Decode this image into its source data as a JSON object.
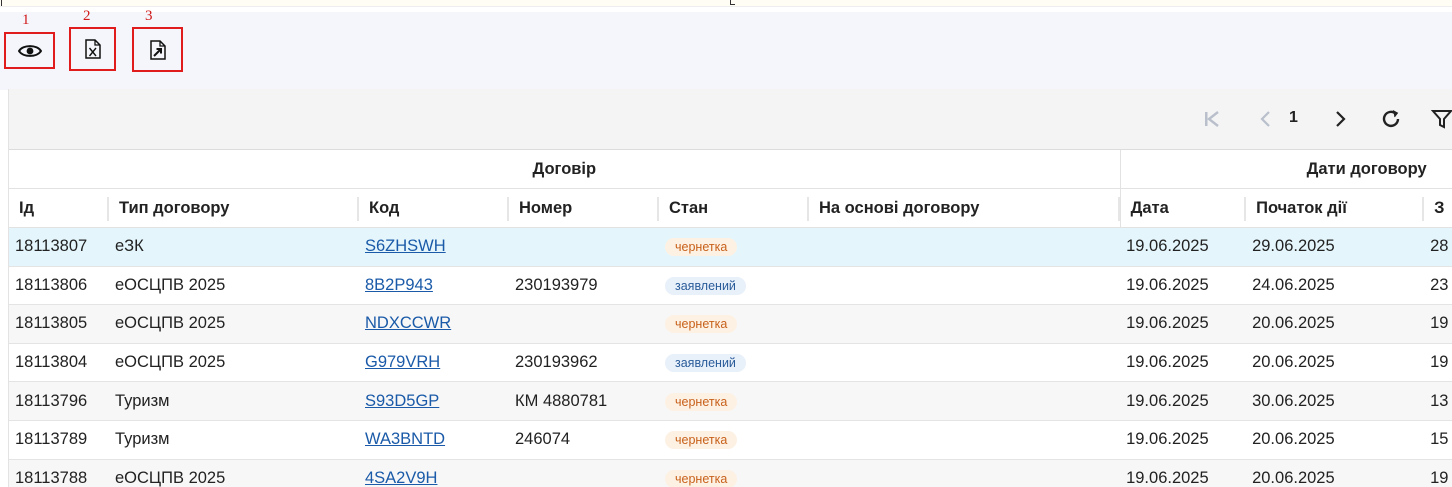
{
  "annotations": [
    "1",
    "2",
    "3"
  ],
  "toolbar_icons": [
    "eye-icon",
    "excel-export-icon",
    "document-export-icon"
  ],
  "pager": {
    "current_page": "1"
  },
  "table": {
    "group_headers": [
      "Договір",
      "Дати договору"
    ],
    "columns": [
      "Ід",
      "Тип договору",
      "Код",
      "Номер",
      "Стан",
      "На основі договору",
      "Дата",
      "Початок дії",
      "З"
    ],
    "rows": [
      {
        "id": "18113807",
        "type": "eЗК",
        "code": "S6ZHSWH",
        "number": "",
        "state": "чернетка",
        "based_on": "",
        "date": "19.06.2025",
        "start": "29.06.2025",
        "end": "28"
      },
      {
        "id": "18113806",
        "type": "eОСЦПВ 2025",
        "code": "8B2P943",
        "number": "230193979",
        "state": "заявлений",
        "based_on": "",
        "date": "19.06.2025",
        "start": "24.06.2025",
        "end": "23"
      },
      {
        "id": "18113805",
        "type": "eОСЦПВ 2025",
        "code": "NDXCCWR",
        "number": "",
        "state": "чернетка",
        "based_on": "",
        "date": "19.06.2025",
        "start": "20.06.2025",
        "end": "19"
      },
      {
        "id": "18113804",
        "type": "eОСЦПВ 2025",
        "code": "G979VRH",
        "number": "230193962",
        "state": "заявлений",
        "based_on": "",
        "date": "19.06.2025",
        "start": "20.06.2025",
        "end": "19"
      },
      {
        "id": "18113796",
        "type": "Туризм",
        "code": "S93D5GP",
        "number": "КМ 4880781",
        "state": "чернетка",
        "based_on": "",
        "date": "19.06.2025",
        "start": "30.06.2025",
        "end": "13"
      },
      {
        "id": "18113789",
        "type": "Туризм",
        "code": "WA3BNTD",
        "number": "246074",
        "state": "чернетка",
        "based_on": "",
        "date": "19.06.2025",
        "start": "20.06.2025",
        "end": "15"
      },
      {
        "id": "18113788",
        "type": "eОСЦПВ 2025",
        "code": "4SA2V9H",
        "number": "",
        "state": "чернетка",
        "based_on": "",
        "date": "19.06.2025",
        "start": "20.06.2025",
        "end": "19"
      }
    ]
  }
}
